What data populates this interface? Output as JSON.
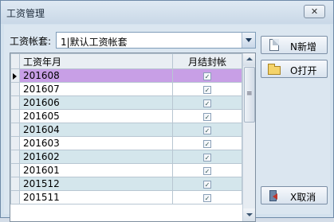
{
  "window": {
    "title": "工资管理",
    "close_label": "✕"
  },
  "account": {
    "label": "工资帐套:",
    "selected": "1|默认工资帐套"
  },
  "grid": {
    "columns": [
      "工资年月",
      "月结封帐"
    ],
    "rows": [
      {
        "month": "201608",
        "closed": true
      },
      {
        "month": "201607",
        "closed": true
      },
      {
        "month": "201606",
        "closed": true
      },
      {
        "month": "201605",
        "closed": true
      },
      {
        "month": "201604",
        "closed": true
      },
      {
        "month": "201603",
        "closed": true
      },
      {
        "month": "201602",
        "closed": true
      },
      {
        "month": "201601",
        "closed": true
      },
      {
        "month": "201512",
        "closed": true
      },
      {
        "month": "201511",
        "closed": true
      }
    ],
    "check_glyph": "✓"
  },
  "buttons": {
    "new": "N新增",
    "open": "O打开",
    "cancel": "X取消"
  },
  "colors": {
    "selected_row": "#c89fe6",
    "alt_row": "#d4e6ec",
    "background": "#dbe6f0"
  }
}
